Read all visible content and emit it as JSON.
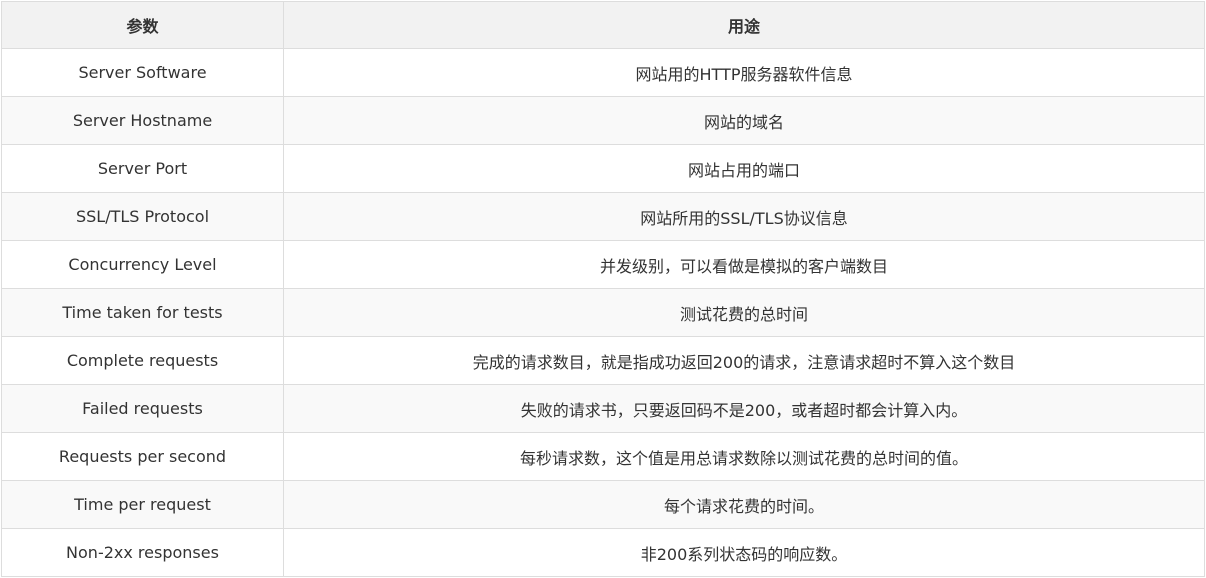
{
  "table": {
    "headers": [
      "参数",
      "用途"
    ],
    "rows": [
      [
        "Server Software",
        "网站用的HTTP服务器软件信息"
      ],
      [
        "Server Hostname",
        "网站的域名"
      ],
      [
        "Server Port",
        "网站占用的端口"
      ],
      [
        "SSL/TLS Protocol",
        "网站所用的SSL/TLS协议信息"
      ],
      [
        "Concurrency Level",
        "并发级别，可以看做是模拟的客户端数目"
      ],
      [
        "Time taken for tests",
        "测试花费的总时间"
      ],
      [
        "Complete requests",
        "完成的请求数目，就是指成功返回200的请求，注意请求超时不算入这个数目"
      ],
      [
        "Failed requests",
        "失败的请求书，只要返回码不是200，或者超时都会计算入内。"
      ],
      [
        "Requests per second",
        "每秒请求数，这个值是用总请求数除以测试花费的总时间的值。"
      ],
      [
        "Time per request",
        "每个请求花费的时间。"
      ],
      [
        "Non-2xx responses",
        "非200系列状态码的响应数。"
      ]
    ]
  }
}
